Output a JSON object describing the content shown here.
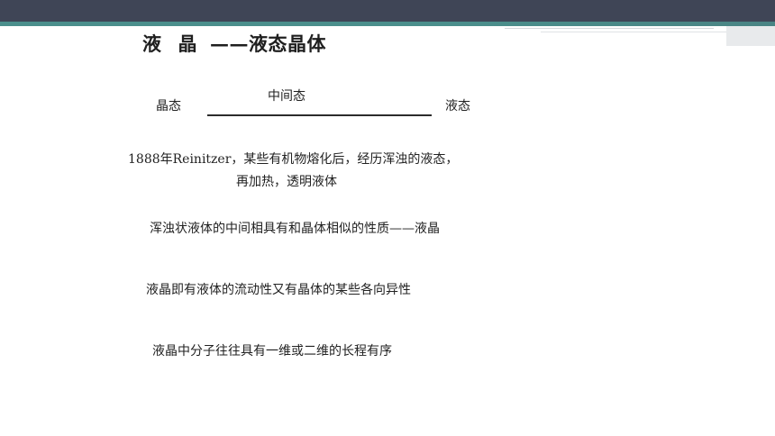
{
  "slide": {
    "title_main": "液",
    "title_second": "晶",
    "title_rest": "——液态晶体",
    "diagram": {
      "left_label": "晶态",
      "middle_label": "中间态",
      "right_label": "液态"
    },
    "paragraphs": [
      "1888年Reinitzer，某些有机物熔化后，经历浑浊的液态，",
      "再加热，透明液体",
      "浑浊状液体的中间相具有和晶体相似的性质——液晶",
      "液晶即有液体的流动性又有晶体的某些各向异性",
      "液晶中分子往往具有一维或二维的长程有序"
    ]
  }
}
